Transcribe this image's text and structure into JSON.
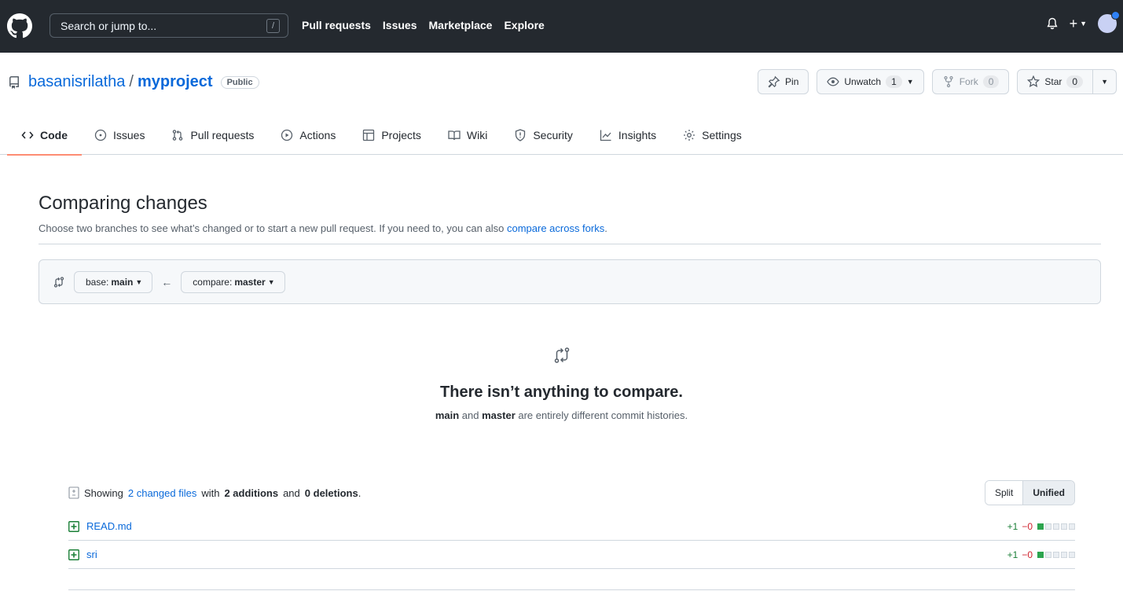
{
  "header": {
    "search_placeholder": "Search or jump to...",
    "search_key": "/",
    "nav": [
      "Pull requests",
      "Issues",
      "Marketplace",
      "Explore"
    ],
    "plus_label": "+"
  },
  "repo": {
    "owner": "basanisrilatha",
    "separator": "/",
    "name": "myproject",
    "visibility": "Public",
    "actions": {
      "pin": "Pin",
      "unwatch": "Unwatch",
      "unwatch_count": "1",
      "fork": "Fork",
      "fork_count": "0",
      "star": "Star",
      "star_count": "0"
    },
    "tabs": [
      {
        "label": "Code",
        "icon": "code-icon",
        "active": true
      },
      {
        "label": "Issues",
        "icon": "issue-opened-icon"
      },
      {
        "label": "Pull requests",
        "icon": "git-pull-request-icon"
      },
      {
        "label": "Actions",
        "icon": "play-icon"
      },
      {
        "label": "Projects",
        "icon": "table-icon"
      },
      {
        "label": "Wiki",
        "icon": "book-icon"
      },
      {
        "label": "Security",
        "icon": "shield-icon"
      },
      {
        "label": "Insights",
        "icon": "graph-icon"
      },
      {
        "label": "Settings",
        "icon": "gear-icon"
      }
    ]
  },
  "compare": {
    "title": "Comparing changes",
    "description": "Choose two branches to see what’s changed or to start a new pull request. If you need to, you can also ",
    "description_link": "compare across forks",
    "description_end": ".",
    "base_prefix": "base:",
    "base_branch": "main",
    "compare_prefix": "compare:",
    "compare_branch": "master",
    "blank_title": "There isn’t anything to compare.",
    "blank_branch_a": "main",
    "blank_and": " and ",
    "blank_branch_b": "master",
    "blank_rest": " are entirely different commit histories."
  },
  "files": {
    "showing": "Showing",
    "changed_link": "2 changed files",
    "with": "with",
    "additions": "2 additions",
    "and": "and",
    "deletions": "0 deletions",
    "end": ".",
    "view_split": "Split",
    "view_unified": "Unified",
    "list": [
      {
        "name": "READ.md",
        "plus": "+1",
        "minus": "−0"
      },
      {
        "name": "sri",
        "plus": "+1",
        "minus": "−0"
      }
    ]
  },
  "colors": {
    "header_bg": "#24292f",
    "link": "#0969da",
    "tab_underline": "#fd8c73",
    "addition": "#2da44e"
  }
}
